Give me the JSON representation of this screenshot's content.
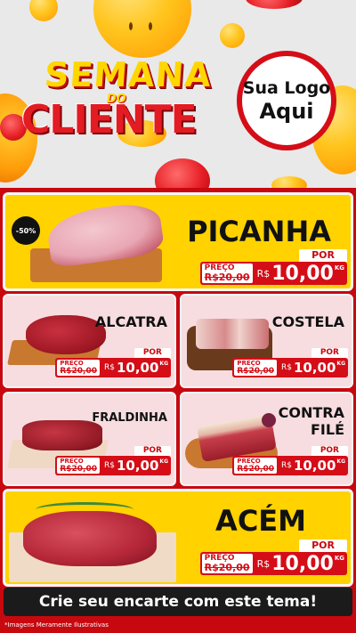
{
  "header": {
    "title_line1": "SEMANA",
    "title_connector": "DO",
    "title_line2": "CLIENTE",
    "logo_line1": "Sua Logo",
    "logo_line2": "Aqui"
  },
  "currency": "R$",
  "products": {
    "picanha": {
      "name": "PICANHA",
      "discount": "-50%",
      "old_label": "PREÇO",
      "old_price": "R$20,00",
      "por_label": "POR",
      "price": "10,00",
      "unit": "KG"
    },
    "alcatra": {
      "name": "ALCATRA",
      "old_label": "PREÇO",
      "old_price": "R$20,00",
      "por_label": "POR",
      "price": "10,00",
      "unit": "KG"
    },
    "costela": {
      "name": "COSTELA",
      "old_label": "PREÇO",
      "old_price": "R$20,00",
      "por_label": "POR",
      "price": "10,00",
      "unit": "KG"
    },
    "fraldinha": {
      "name": "FRALDINHA",
      "old_label": "PREÇO",
      "old_price": "R$20,00",
      "por_label": "POR",
      "price": "10,00",
      "unit": "KG"
    },
    "contra_file": {
      "name_line1": "CONTRA",
      "name_line2": "FILÉ",
      "old_label": "PREÇO",
      "old_price": "R$20,00",
      "por_label": "POR",
      "price": "10,00",
      "unit": "KG"
    },
    "acem": {
      "name": "ACÉM",
      "old_label": "PREÇO",
      "old_price": "R$20,00",
      "por_label": "POR",
      "price": "10,00",
      "unit": "KG"
    }
  },
  "cta": "Crie seu encarte com este tema!",
  "disclaimer": "*Imagens Meramente Ilustrativas",
  "colors": {
    "brand_red": "#c8080f",
    "brand_yellow": "#ffd200",
    "card_pink": "#f7dde0",
    "cta_black": "#1b1b1b"
  }
}
